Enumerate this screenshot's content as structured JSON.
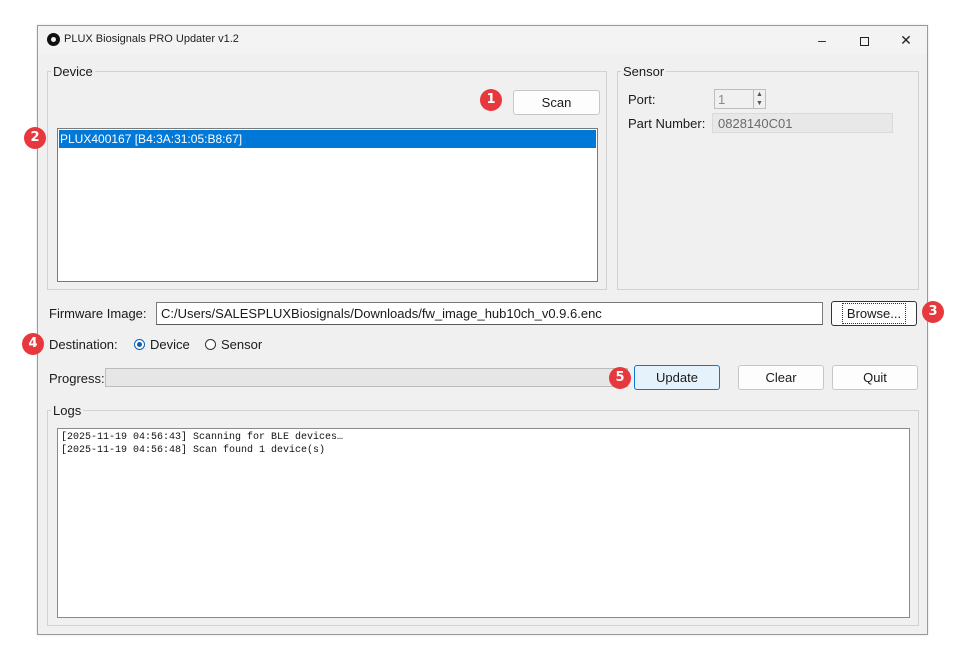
{
  "window": {
    "title": "PLUX Biosignals PRO Updater v1.2",
    "controls": {
      "minimize": "–",
      "close": "✕"
    }
  },
  "device_group": {
    "legend": "Device",
    "scan_label": "Scan",
    "devices": [
      "PLUX400167 [B4:3A:31:05:B8:67]"
    ],
    "selected_index": 0
  },
  "sensor_group": {
    "legend": "Sensor",
    "port_label": "Port:",
    "port_value": "1",
    "part_number_label": "Part Number:",
    "part_number_value": "0828140C01"
  },
  "firmware": {
    "label": "Firmware Image:",
    "path": "C:/Users/SALESPLUXBiosignals/Downloads/fw_image_hub10ch_v0.9.6.enc",
    "browse_label": "Browse..."
  },
  "destination": {
    "label": "Destination:",
    "options": [
      "Device",
      "Sensor"
    ],
    "selected": "Device"
  },
  "progress": {
    "label": "Progress:",
    "value_percent": 0
  },
  "actions": {
    "update_label": "Update",
    "clear_label": "Clear",
    "quit_label": "Quit"
  },
  "logs": {
    "legend": "Logs",
    "lines": [
      "[2025-11-19 04:56:43] Scanning for BLE devices…",
      "[2025-11-19 04:56:48] Scan found 1 device(s)"
    ]
  },
  "annotations": [
    "1",
    "2",
    "3",
    "4",
    "5"
  ],
  "colors": {
    "selection": "#0078d7",
    "badge": "#e7383d",
    "focus_button": "#e5f1fb",
    "radio_checked": "#0f5fb0"
  }
}
